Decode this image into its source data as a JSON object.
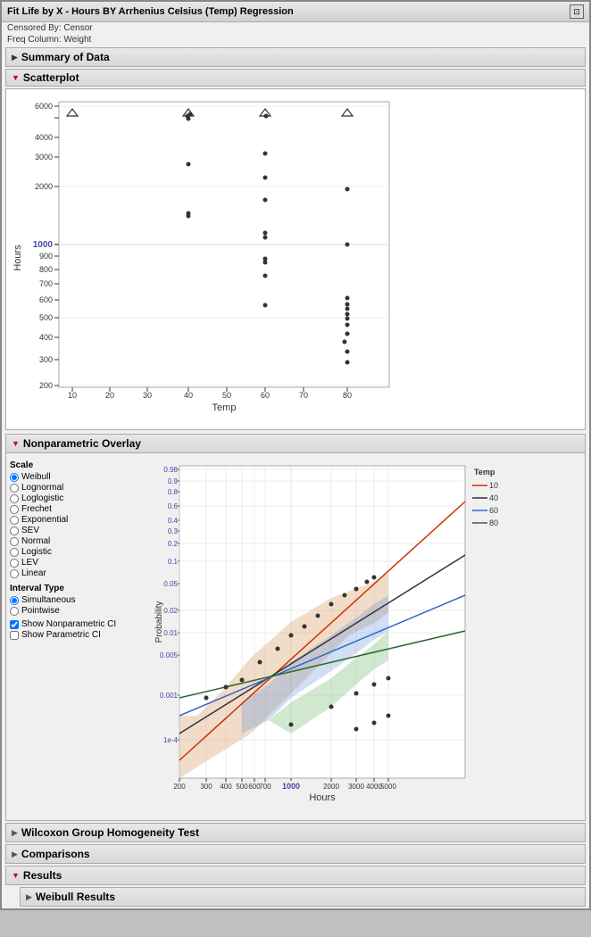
{
  "window": {
    "title": "Fit Life by X - Hours BY Arrhenius Celsius (Temp) Regression",
    "censored_by_label": "Censored By:",
    "censored_by_value": "Censor",
    "freq_col_label": "Freq Column:",
    "freq_col_value": "Weight"
  },
  "summary_section": {
    "label": "Summary of Data"
  },
  "scatterplot_section": {
    "label": "Scatterplot",
    "x_axis_label": "Temp",
    "y_axis_label": "Hours"
  },
  "nonparam_section": {
    "label": "Nonparametric Overlay",
    "scale_label": "Scale",
    "scale_options": [
      "Weibull",
      "Lognormal",
      "Loglogistic",
      "Frechet",
      "Exponential",
      "SEV",
      "Normal",
      "Logistic",
      "LEV",
      "Linear"
    ],
    "selected_scale": "Weibull",
    "interval_type_label": "Interval Type",
    "interval_options": [
      "Simultaneous",
      "Pointwise"
    ],
    "selected_interval": "Simultaneous",
    "show_nonparam_ci_label": "Show Nonparametric CI",
    "show_nonparam_ci_checked": true,
    "show_param_ci_label": "Show Parametric CI",
    "show_param_ci_checked": false,
    "x_axis_label": "Hours",
    "y_axis_label": "Probability",
    "legend_label": "Temp",
    "legend_items": [
      {
        "color": "#cc3300",
        "label": "10"
      },
      {
        "color": "#333333",
        "label": "40"
      },
      {
        "color": "#3366cc",
        "label": "60"
      },
      {
        "color": "#336633",
        "label": "80"
      }
    ]
  },
  "wilcoxon_section": {
    "label": "Wilcoxon Group Homogeneity Test"
  },
  "comparisons_section": {
    "label": "Comparisons"
  },
  "results_section": {
    "label": "Results",
    "expanded": true
  },
  "weibull_results_section": {
    "label": "Weibull Results"
  }
}
